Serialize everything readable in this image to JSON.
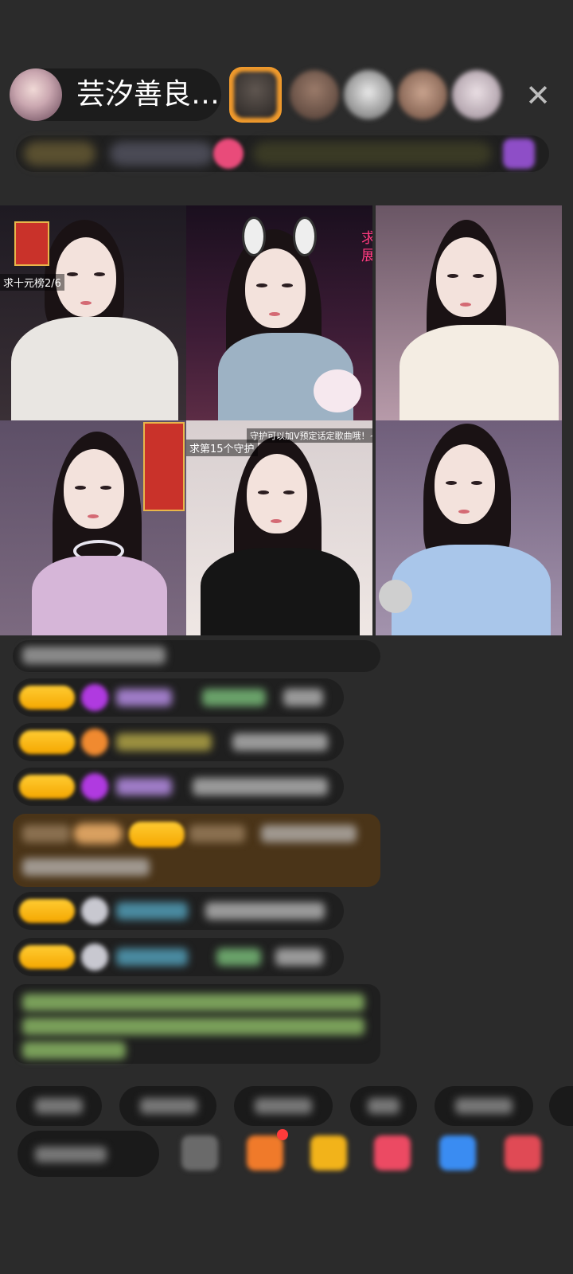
{
  "host": {
    "name": "芸汐善良…"
  },
  "actions": {
    "close_icon": "close-icon"
  },
  "room": {
    "rooms": [
      {
        "overlay": "求十元榜2/6"
      },
      {
        "overlay": "求展"
      },
      {
        "overlay": ""
      },
      {
        "overlay": ""
      },
      {
        "overlay": "求第15个守护"
      },
      {
        "overlay": ""
      }
    ],
    "room5_banner": "守护可以加V预定话定歌曲哦！~"
  },
  "colors": {
    "background": "#2b2b2b",
    "badge": "#f5a700",
    "chat_highlight": "#4a3418",
    "notice_text": "#9ed07a"
  }
}
